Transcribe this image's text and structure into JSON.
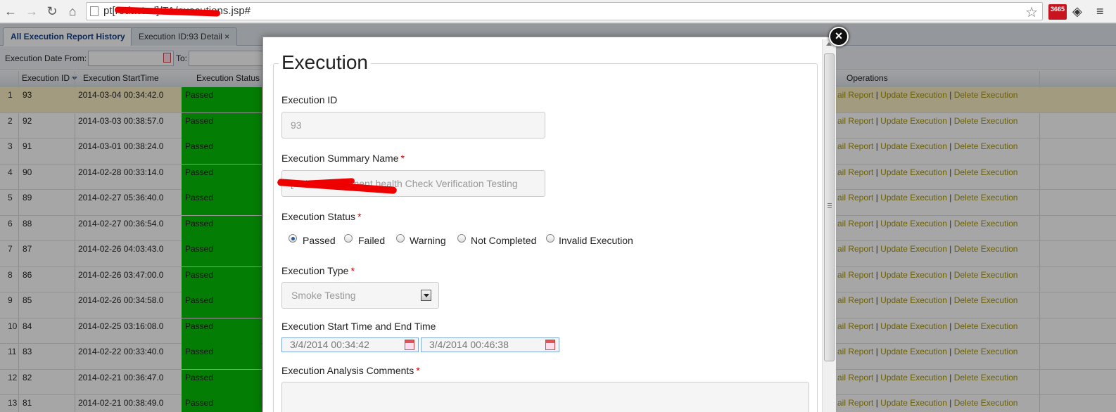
{
  "browser": {
    "url": "pt[redacted]/TA/executions.jsp#",
    "nav": {
      "back": "←",
      "forward": "→",
      "reload": "↻",
      "home": "⌂",
      "star": "☆"
    },
    "ext1": "3665"
  },
  "tabs": [
    {
      "label": "All Execution Report History"
    },
    {
      "label": "Execution ID:93 Detail ×"
    }
  ],
  "filter": {
    "date_from_label": "Execution Date From:",
    "to_label": "To:"
  },
  "grid": {
    "columns": {
      "id": "Execution ID",
      "start": "Execution StartTime",
      "status": "Execution Status",
      "ops": "Operations"
    },
    "op_labels": {
      "detail": "ail Report",
      "update": "Update Execution",
      "delete": "Delete Execution",
      "sep": "|"
    },
    "rows": [
      {
        "n": "1",
        "id": "93",
        "time": "2014-03-04 00:34:42.0",
        "status": "Passed"
      },
      {
        "n": "2",
        "id": "92",
        "time": "2014-03-03 00:38:57.0",
        "status": "Passed"
      },
      {
        "n": "3",
        "id": "91",
        "time": "2014-03-01 00:38:24.0",
        "status": "Passed"
      },
      {
        "n": "4",
        "id": "90",
        "time": "2014-02-28 00:33:14.0",
        "status": "Passed"
      },
      {
        "n": "5",
        "id": "89",
        "time": "2014-02-27 05:36:40.0",
        "status": "Passed"
      },
      {
        "n": "6",
        "id": "88",
        "time": "2014-02-27 00:36:54.0",
        "status": "Passed"
      },
      {
        "n": "7",
        "id": "87",
        "time": "2014-02-26 04:03:43.0",
        "status": "Passed"
      },
      {
        "n": "8",
        "id": "86",
        "time": "2014-02-26 03:47:00.0",
        "status": "Passed"
      },
      {
        "n": "9",
        "id": "85",
        "time": "2014-02-26 00:34:58.0",
        "status": "Passed"
      },
      {
        "n": "10",
        "id": "84",
        "time": "2014-02-25 03:16:08.0",
        "status": "Passed"
      },
      {
        "n": "11",
        "id": "83",
        "time": "2014-02-22 00:33:40.0",
        "status": "Passed"
      },
      {
        "n": "12",
        "id": "82",
        "time": "2014-02-21 00:36:47.0",
        "status": "Passed"
      },
      {
        "n": "13",
        "id": "81",
        "time": "2014-02-21 00:38:49.0",
        "status": "Passed"
      }
    ]
  },
  "modal": {
    "title": "Execution",
    "close": "×",
    "fields": {
      "id_label": "Execution ID",
      "id_value": "93",
      "summary_label": "Execution Summary Name",
      "summary_value": "[redacted]ironment health Check Verification Testing",
      "status_label": "Execution Status",
      "status_options": [
        "Passed",
        "Failed",
        "Warning",
        "Not Completed",
        "Invalid Execution"
      ],
      "type_label": "Execution Type",
      "type_value": "Smoke Testing",
      "time_label": "Execution Start Time and End Time",
      "start_time": "3/4/2014 00:34:42",
      "end_time": "3/4/2014 00:46:38",
      "comments_label": "Execution Analysis Comments",
      "required": "*"
    }
  }
}
